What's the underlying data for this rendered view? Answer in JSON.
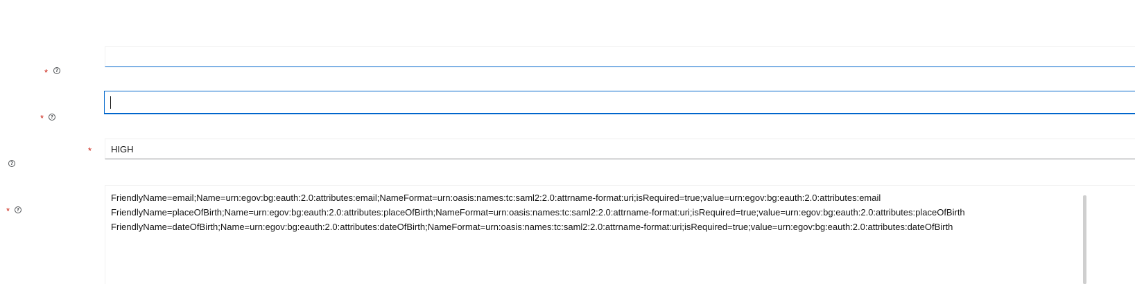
{
  "form": {
    "field_1": {
      "value": ""
    },
    "field_2": {
      "value": ""
    },
    "field_3": {
      "value": "HIGH"
    },
    "field_4": {
      "value": "FriendlyName=email;Name=urn:egov:bg:eauth:2.0:attributes:email;NameFormat=urn:oasis:names:tc:saml2:2.0:attrname-format:uri;isRequired=true;value=urn:egov:bg:eauth:2.0:attributes:email\nFriendlyName=placeOfBirth;Name=urn:egov:bg:eauth:2.0:attributes:placeOfBirth;NameFormat=urn:oasis:names:tc:saml2:2.0:attrname-format:uri;isRequired=true;value=urn:egov:bg:eauth:2.0:attributes:placeOfBirth\nFriendlyName=dateOfBirth;Name=urn:egov:bg:eauth:2.0:attributes:dateOfBirth;NameFormat=urn:oasis:names:tc:saml2:2.0:attrname-format:uri;isRequired=true;value=urn:egov:bg:eauth:2.0:attributes:dateOfBirth"
    }
  },
  "markers": {
    "required": "*",
    "help": "?"
  },
  "icons": {
    "help": "help-circle-icon"
  },
  "colors": {
    "required": "#c9190b",
    "focus": "#06c",
    "border": "#f0f0f0"
  }
}
